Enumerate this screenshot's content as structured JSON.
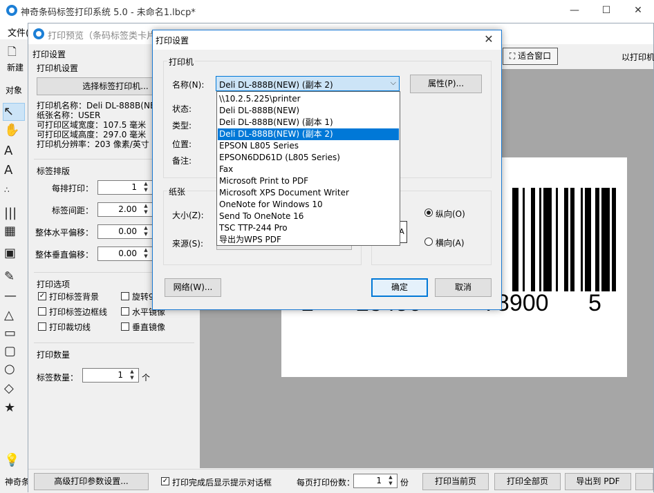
{
  "main_window": {
    "title": "神奇条码标签打印系统 5.0 - 未命名1.lbcp*",
    "menu_file": "文件(",
    "new_label": "新建",
    "object_label": "对象",
    "status_left": "神奇条",
    "controls": {
      "minimize": "—",
      "maximize": "☐",
      "close": "✕"
    }
  },
  "preview_window": {
    "title": "打印预览（条码标签类卡片）",
    "fit_window": "适合窗口",
    "printer_right": "以打印机",
    "settings": {
      "heading": "打印设置",
      "printer_group": "打印机设置",
      "select_printer": "选择标签打印机...",
      "info": [
        "打印机名称：Deli DL-888B(NEW",
        "纸张名称：USER",
        "可打印区域宽度：107.5 毫米",
        "可打印区域高度：297.0 毫米",
        "打印机分辨率：203 像素/英寸"
      ],
      "layout_group": "标签排版",
      "per_row_label": "每排打印：",
      "per_row_value": "1",
      "spacing_label": "标签间距：",
      "spacing_value": "2.00",
      "h_offset_label": "整体水平偏移：",
      "h_offset_value": "0.00",
      "v_offset_label": "整体垂直偏移：",
      "v_offset_value": "0.00",
      "options_group": "打印选项",
      "opt_background": "打印标签背景",
      "opt_border": "打印标签边框线",
      "opt_cutline": "打印裁切线",
      "opt_rotate": "旋转9",
      "opt_hmirror": "水平镜像",
      "opt_vmirror": "垂直镜像",
      "qty_group": "打印数量",
      "qty_label": "标签数量：",
      "qty_value": "1",
      "qty_unit": "个"
    },
    "barcode_digits": [
      "1",
      "23456",
      "78900",
      "5"
    ],
    "bottom": {
      "advanced": "高级打印参数设置...",
      "show_dialog": "打印完成后显示提示对话框",
      "copies_label": "每页打印份数：",
      "copies_value": "1",
      "copies_unit": "份",
      "print_current": "打印当前页",
      "print_all": "打印全部页",
      "export_pdf": "导出到 PDF"
    }
  },
  "dialog": {
    "title": "打印设置",
    "printer_group": "打印机",
    "name_label": "名称(N):",
    "name_value": "Deli DL-888B(NEW) (副本 2)",
    "properties_button": "属性(P)...",
    "status_label": "状态:",
    "type_label": "类型:",
    "location_label": "位置:",
    "comment_label": "备注:",
    "printer_options": [
      "\\\\10.2.5.225\\printer",
      "Deli DL-888B(NEW)",
      "Deli DL-888B(NEW) (副本 1)",
      "Deli DL-888B(NEW) (副本 2)",
      "EPSON L805 Series",
      "EPSON6DD61D (L805 Series)",
      "Fax",
      "Microsoft Print to PDF",
      "Microsoft XPS Document Writer",
      "OneNote for Windows 10",
      "Send To OneNote 16",
      "TSC TTP-244 Pro",
      "导出为WPS PDF"
    ],
    "selected_index": 3,
    "paper_group": "纸张",
    "size_label": "大小(Z):",
    "source_label": "来源(S):",
    "portrait_label": "纵向(O)",
    "landscape_label": "横向(A)",
    "network_button": "网络(W)...",
    "ok_button": "确定",
    "cancel_button": "取消",
    "close": "✕"
  }
}
